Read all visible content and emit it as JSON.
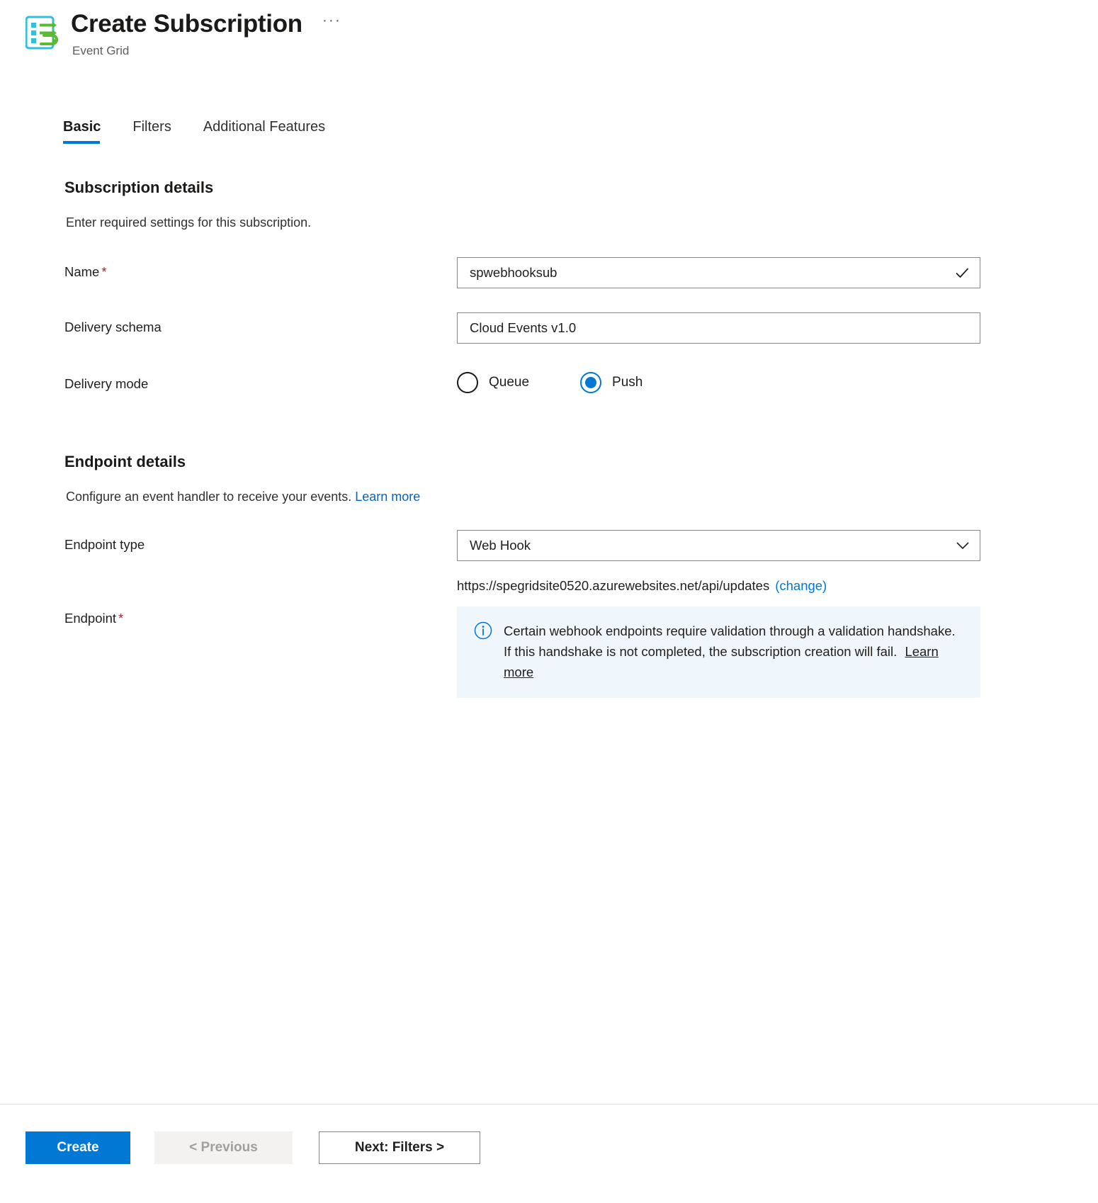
{
  "header": {
    "title": "Create Subscription",
    "subtitle": "Event Grid",
    "more_label": "···",
    "icon": "event-grid-subscription-icon"
  },
  "tabs": [
    {
      "label": "Basic",
      "active": true
    },
    {
      "label": "Filters",
      "active": false
    },
    {
      "label": "Additional Features",
      "active": false
    }
  ],
  "subscription_details": {
    "heading": "Subscription details",
    "description": "Enter required settings for this subscription.",
    "name": {
      "label": "Name",
      "required_marker": "*",
      "value": "spwebhooksub",
      "validation_icon": "checkmark-icon"
    },
    "delivery_schema": {
      "label": "Delivery schema",
      "value": "Cloud Events v1.0"
    },
    "delivery_mode": {
      "label": "Delivery mode",
      "options": [
        {
          "label": "Queue",
          "selected": false
        },
        {
          "label": "Push",
          "selected": true
        }
      ]
    }
  },
  "endpoint_details": {
    "heading": "Endpoint details",
    "description": "Configure an event handler to receive your events.",
    "description_link": "Learn more",
    "endpoint_type": {
      "label": "Endpoint type",
      "value": "Web Hook",
      "caret_icon": "chevron-down-icon"
    },
    "endpoint": {
      "label": "Endpoint",
      "required_marker": "*",
      "url": "https://spegridsite0520.azurewebsites.net/api/updates",
      "change_link": "(change)"
    },
    "info": {
      "icon": "info-circle-icon",
      "text": "Certain webhook endpoints require validation through a validation handshake. If this handshake is not completed, the subscription creation will fail.",
      "link": "Learn more"
    }
  },
  "footer": {
    "create_label": "Create",
    "previous_label": "< Previous",
    "next_label": "Next: Filters >"
  },
  "colors": {
    "accent": "#0078d4",
    "required": "#a4262c",
    "info_bg": "#eff6fc",
    "icon_blue": "#32bedd",
    "icon_green": "#5bb934"
  }
}
